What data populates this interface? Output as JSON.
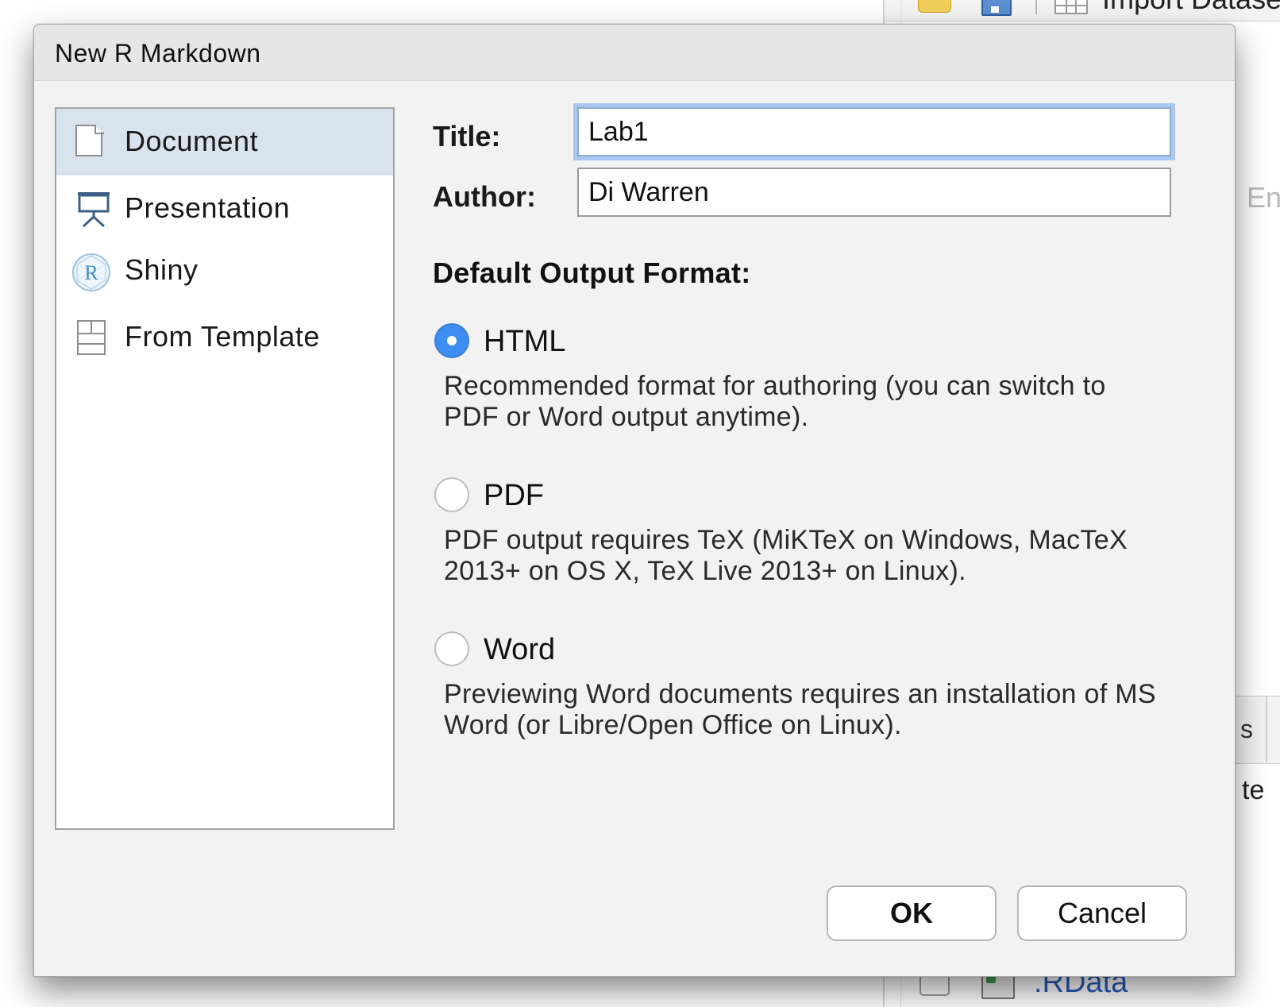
{
  "background": {
    "toolbar_button": "Import Dataset",
    "right_text": "En",
    "tab_fragment": "s",
    "row_fragment": "te",
    "file_name": ".RData",
    "icons": [
      "folder-icon",
      "save-icon",
      "table-icon",
      "rdata-file-icon"
    ]
  },
  "dialog": {
    "title": "New R Markdown",
    "types": [
      {
        "label": "Document",
        "icon": "document-icon",
        "selected": true
      },
      {
        "label": "Presentation",
        "icon": "presentation-icon",
        "selected": false
      },
      {
        "label": "Shiny",
        "icon": "shiny-icon",
        "selected": false
      },
      {
        "label": "From Template",
        "icon": "template-icon",
        "selected": false
      }
    ],
    "form": {
      "title_label": "Title:",
      "title_value": "Lab1",
      "author_label": "Author:",
      "author_value": "Di Warren",
      "output_heading": "Default Output Format:",
      "formats": [
        {
          "label": "HTML",
          "selected": true,
          "description": "Recommended format for authoring (you can switch to PDF or Word output anytime)."
        },
        {
          "label": "PDF",
          "selected": false,
          "description": "PDF output requires TeX (MiKTeX on Windows, MacTeX 2013+ on OS X, TeX Live 2013+ on Linux)."
        },
        {
          "label": "Word",
          "selected": false,
          "description": "Previewing Word documents requires an installation of MS Word (or Libre/Open Office on Linux)."
        }
      ]
    },
    "buttons": {
      "ok": "OK",
      "cancel": "Cancel"
    }
  },
  "colors": {
    "selected_row": "#d8e3ee",
    "radio_checked": "#3d8ef0",
    "focus_ring": "#a9c8ef",
    "dialog_bg": "#f2f2f2"
  }
}
